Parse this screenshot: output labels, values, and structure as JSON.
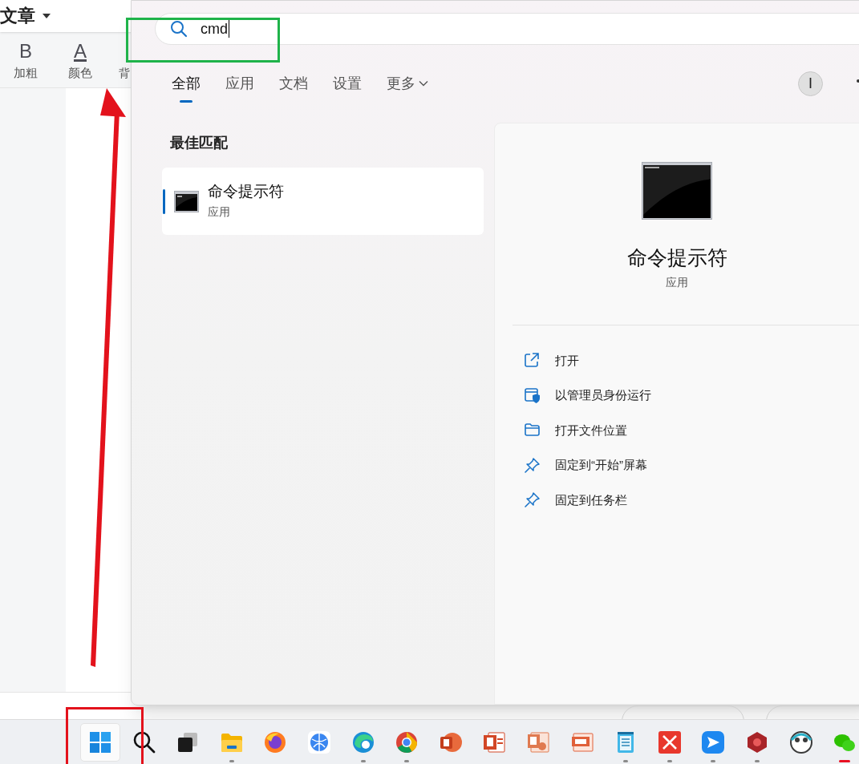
{
  "editor": {
    "title": "文章",
    "toolbar": [
      {
        "glyph": "B",
        "label": "加粗"
      },
      {
        "glyph": "A",
        "label": "颜色"
      },
      {
        "label": "背"
      }
    ]
  },
  "search": {
    "value": "cmd"
  },
  "tabs": [
    {
      "label": "全部",
      "selected": true,
      "kind": "plain"
    },
    {
      "label": "应用",
      "selected": false,
      "kind": "plain"
    },
    {
      "label": "文档",
      "selected": false,
      "kind": "plain"
    },
    {
      "label": "设置",
      "selected": false,
      "kind": "plain"
    },
    {
      "label": "更多",
      "selected": false,
      "kind": "menu"
    }
  ],
  "account": {
    "initial": "I"
  },
  "best_match": {
    "heading": "最佳匹配",
    "item": {
      "title": "命令提示符",
      "subtitle": "应用",
      "selected": true
    }
  },
  "detail": {
    "title": "命令提示符",
    "subtitle": "应用",
    "actions": [
      {
        "label": "打开",
        "kind": "open"
      },
      {
        "label": "以管理员身份运行",
        "kind": "admin"
      },
      {
        "label": "打开文件位置",
        "kind": "folder"
      },
      {
        "label": "固定到“开始”屏幕",
        "kind": "pin"
      },
      {
        "label": "固定到任务栏",
        "kind": "pin"
      }
    ]
  },
  "taskbar": [
    {
      "kind": "start",
      "running": false,
      "attention": false,
      "selected": true
    },
    {
      "kind": "search",
      "running": false,
      "attention": false,
      "selected": false
    },
    {
      "kind": "taskview",
      "running": false,
      "attention": false,
      "selected": false
    },
    {
      "kind": "folder",
      "running": true,
      "attention": false,
      "selected": false
    },
    {
      "kind": "fox",
      "running": false,
      "attention": false,
      "selected": false
    },
    {
      "kind": "globe",
      "running": false,
      "attention": false,
      "selected": false
    },
    {
      "kind": "swirl",
      "running": true,
      "attention": false,
      "selected": false
    },
    {
      "kind": "wheel",
      "running": true,
      "attention": false,
      "selected": false
    },
    {
      "kind": "slides-round",
      "running": false,
      "attention": false,
      "selected": false
    },
    {
      "kind": "slides",
      "running": false,
      "attention": false,
      "selected": false
    },
    {
      "kind": "slides-light",
      "running": false,
      "attention": false,
      "selected": false
    },
    {
      "kind": "slides-doc",
      "running": false,
      "attention": false,
      "selected": false
    },
    {
      "kind": "notepad",
      "running": true,
      "attention": false,
      "selected": false
    },
    {
      "kind": "cross",
      "running": true,
      "attention": false,
      "selected": false
    },
    {
      "kind": "plane",
      "running": true,
      "attention": false,
      "selected": false
    },
    {
      "kind": "hexagon",
      "running": true,
      "attention": false,
      "selected": false
    },
    {
      "kind": "round",
      "running": false,
      "attention": false,
      "selected": false
    },
    {
      "kind": "chat",
      "running": true,
      "attention": true,
      "selected": false
    }
  ]
}
